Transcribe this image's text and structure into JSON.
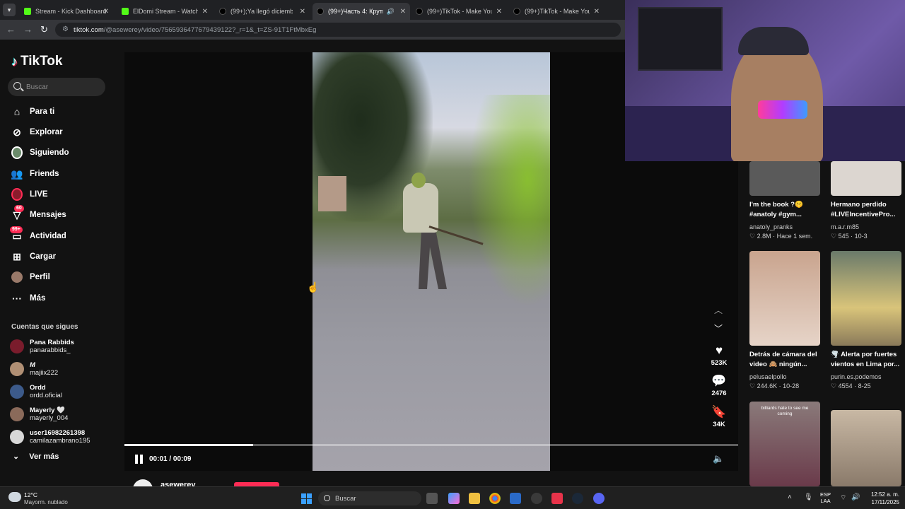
{
  "browser": {
    "tabs": [
      {
        "title": "Stream - Kick Dashboard",
        "fav": "kick",
        "active": false
      },
      {
        "title": "ElDomi Stream - Watch Li",
        "fav": "kick",
        "active": false
      },
      {
        "title": "(99+);Ya llegó diciembre!",
        "fav": "tt",
        "active": false
      },
      {
        "title": "(99+)Часть 4: Крутые",
        "fav": "tt",
        "active": true
      },
      {
        "title": "(99+)TikTok - Make Your",
        "fav": "tt",
        "active": false
      },
      {
        "title": "(99+)TikTok - Make Your",
        "fav": "tt",
        "active": false
      }
    ],
    "url_host": "tiktok.com",
    "url_path": "/@asewerey/video/7565936477679439122?_r=1&_t=ZS-91T1FtMbxEg"
  },
  "sidebar": {
    "logo": "TikTok",
    "search_placeholder": "Buscar",
    "nav": [
      {
        "label": "Para ti",
        "icon": "home-icon"
      },
      {
        "label": "Explorar",
        "icon": "compass-icon"
      },
      {
        "label": "Siguiendo",
        "icon": "following-avatar-icon"
      },
      {
        "label": "Friends",
        "icon": "friends-icon"
      },
      {
        "label": "LIVE",
        "icon": "live-icon"
      },
      {
        "label": "Mensajes",
        "icon": "messages-icon",
        "badge": "60"
      },
      {
        "label": "Actividad",
        "icon": "activity-icon",
        "badge": "99+"
      },
      {
        "label": "Cargar",
        "icon": "upload-icon"
      },
      {
        "label": "Perfil",
        "icon": "profile-icon"
      },
      {
        "label": "Más",
        "icon": "more-icon"
      }
    ],
    "following_title": "Cuentas que sigues",
    "accounts": [
      {
        "name": "Pana Rabbids",
        "handle": "panarabbids_",
        "color": "#7a1c2c"
      },
      {
        "name": "M",
        "handle": "majiix222",
        "color": "#b08f74"
      },
      {
        "name": "Ordd",
        "handle": "ordd.oficial",
        "color": "#3c5a8a"
      },
      {
        "name": "Mayerly 🤍",
        "handle": "mayerly_004",
        "color": "#8a6a5a"
      },
      {
        "name": "user16982261398",
        "handle": "camilazambrano195",
        "color": "#d8d8d8"
      }
    ],
    "see_more": "Ver más"
  },
  "player": {
    "time": "00:01 / 00:09",
    "progress_percent": 21,
    "author": "asewerey",
    "likes": "523K",
    "comments": "2476",
    "saves": "34K"
  },
  "recommended": [
    {
      "title": "I'm the book ?🤫 #anatoly #gym...",
      "user": "anatoly_pranks",
      "stats": "♡ 2.8M · Hace 1 sem.",
      "color": "#5a5a5a"
    },
    {
      "title": "Hermano perdido #LIVEIncentivePro...",
      "user": "m.a.r.m85",
      "stats": "♡ 545 · 10-3",
      "color": "#dcd6d0"
    },
    {
      "title": "Detrás de cámara del video 🙈 ningún...",
      "user": "pelusaelpollo",
      "stats": "♡ 244.6K · 10-28",
      "color": "#c9a48e"
    },
    {
      "title": "🌪️ Alerta por fuertes vientos en Lima por...",
      "user": "purin.es.podemos",
      "stats": "♡ 4554 · 8-25",
      "color": "#d9c47a"
    },
    {
      "title": "billiards hate to see me coming",
      "user": "",
      "stats": "",
      "color": "#7a6a6a"
    },
    {
      "title": "",
      "user": "",
      "stats": "",
      "color": "#b8a894"
    }
  ],
  "taskbar": {
    "temp": "12°C",
    "weather": "Mayorm. nublado",
    "search": "Buscar",
    "lang": "ESP",
    "lang2": "LAA",
    "time": "12:52 a. m.",
    "date": "17/11/2025"
  }
}
